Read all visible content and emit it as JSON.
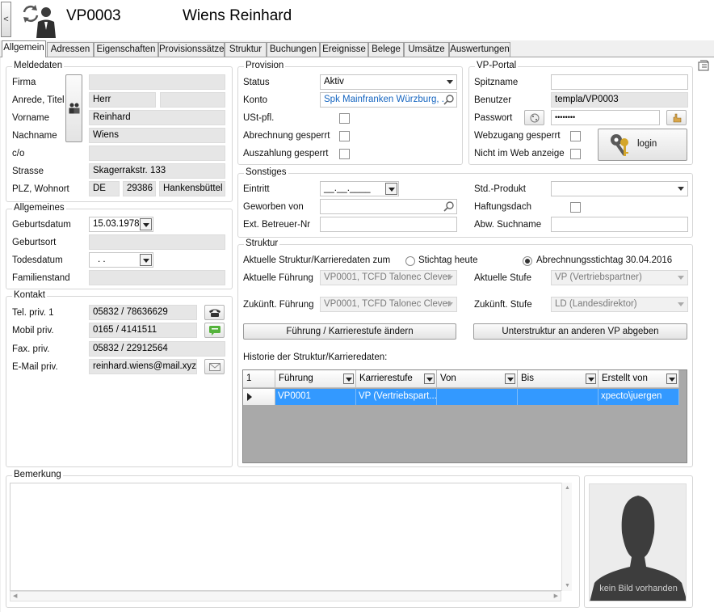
{
  "header": {
    "back_label": "<",
    "vp_number": "VP0003",
    "name": "Wiens Reinhard"
  },
  "tabs": [
    "Allgemein",
    "Adressen",
    "Eigenschaften",
    "Provisionssätze",
    "Struktur",
    "Buchungen",
    "Ereignisse",
    "Belege",
    "Umsätze",
    "Auswertungen"
  ],
  "meldedaten": {
    "legend": "Meldedaten",
    "firma_label": "Firma",
    "firma": "",
    "anrede_label": "Anrede, Titel",
    "anrede": "Herr",
    "titel": "",
    "vorname_label": "Vorname",
    "vorname": "Reinhard",
    "nachname_label": "Nachname",
    "nachname": "Wiens",
    "co_label": "c/o",
    "co": "",
    "strasse_label": "Strasse",
    "strasse": "Skagerrakstr. 133",
    "plz_label": "PLZ, Wohnort",
    "land": "DE",
    "plz": "29386",
    "ort": "Hankensbüttel"
  },
  "allgemeines": {
    "legend": "Allgemeines",
    "geburtsdatum_label": "Geburtsdatum",
    "geburtsdatum": "15.03.1978",
    "geburtsort_label": "Geburtsort",
    "geburtsort": "",
    "todesdatum_label": "Todesdatum",
    "todesdatum": ". .",
    "familienstand_label": "Familienstand",
    "familienstand": ""
  },
  "kontakt": {
    "legend": "Kontakt",
    "tel_label": "Tel. priv. 1",
    "tel": "05832 / 78636629",
    "mobil_label": "Mobil priv.",
    "mobil": "0165 / 4141511",
    "fax_label": "Fax. priv.",
    "fax": "05832 / 22912564",
    "email_label": "E-Mail priv.",
    "email": "reinhard.wiens@mail.xyz"
  },
  "provision": {
    "legend": "Provision",
    "status_label": "Status",
    "status": "Aktiv",
    "konto_label": "Konto",
    "konto": "Spk Mainfranken Würzburg, . .",
    "ust_label": "USt-pfl.",
    "abrechnung_label": "Abrechnung gesperrt",
    "auszahlung_label": "Auszahlung gesperrt"
  },
  "portal": {
    "legend": "VP-Portal",
    "spitzname_label": "Spitzname",
    "spitzname": "",
    "benutzer_label": "Benutzer",
    "benutzer": "templa/VP0003",
    "passwort_label": "Passwort",
    "passwort": "••••••••",
    "webzugang_label": "Webzugang gesperrt",
    "nichtweb_label": "Nicht im Web anzeige",
    "login_label": "login"
  },
  "sonstiges": {
    "legend": "Sonstiges",
    "eintritt_label": "Eintritt",
    "eintritt": "__.__.____",
    "geworben_label": "Geworben von",
    "geworben": "",
    "extbetreuer_label": "Ext. Betreuer-Nr",
    "extbetreuer": "",
    "stdprodukt_label": "Std.-Produkt",
    "stdprodukt": "",
    "haftungsdach_label": "Haftungsdach",
    "abwsuchname_label": "Abw. Suchname",
    "abwsuchname": ""
  },
  "struktur": {
    "legend": "Struktur",
    "aktuell_label": "Aktuelle Struktur/Karrieredaten zum",
    "radio1": "Stichtag heute",
    "radio2": "Abrechnungsstichtag 30.04.2016",
    "fuehrung_label": "Aktuelle Führung",
    "fuehrung": "VP0001, TCFD Talonec Clever",
    "stufe_label": "Aktuelle Stufe",
    "stufe": "VP (Vertriebspartner)",
    "zuk_fuehrung_label": "Zukünft. Führung",
    "zuk_fuehrung": "VP0001, TCFD Talonec Clever",
    "zuk_stufe_label": "Zukünft. Stufe",
    "zuk_stufe": "LD (Landesdirektor)",
    "btn_aendern": "Führung / Karrierestufe ändern",
    "btn_abgeben": "Unterstruktur an anderen VP abgeben",
    "historie_label": "Historie der Struktur/Karrieredaten:",
    "grid": {
      "count": "1",
      "columns": [
        "Führung",
        "Karrierestufe",
        "Von",
        "Bis",
        "Erstellt von"
      ],
      "rows": [
        [
          "VP0001",
          "VP (Vertriebspart...",
          "",
          "",
          "xpecto\\juergen"
        ]
      ]
    }
  },
  "bemerkung": {
    "legend": "Bemerkung",
    "text": ""
  },
  "photo": {
    "caption": "kein Bild vorhanden"
  }
}
